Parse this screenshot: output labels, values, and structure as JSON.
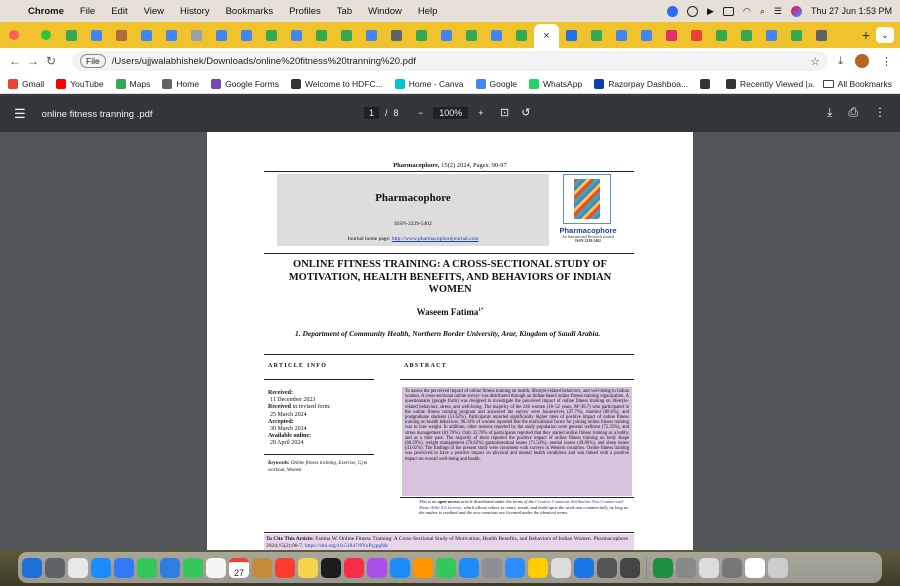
{
  "menubar": {
    "app_name": "Chrome",
    "items": [
      "File",
      "Edit",
      "View",
      "History",
      "Bookmarks",
      "Profiles",
      "Tab",
      "Window",
      "Help"
    ],
    "clock": "Thu 27 Jun  1:53 PM"
  },
  "tabs": {
    "favicon_colors": [
      "#34a853",
      "#4285f4",
      "#b06a3b",
      "#4285f4",
      "#4285f4",
      "#9aa0a6",
      "#4285f4",
      "#4285f4",
      "#34a853",
      "#4285f4",
      "#34a853",
      "#34a853",
      "#4285f4",
      "#5f6368",
      "#34a853",
      "#4285f4",
      "#34a853",
      "#4285f4",
      "#34a853",
      "#1a73e8",
      "#34a853",
      "#4285f4",
      "#4285f4",
      "#e1306c",
      "#ea4335",
      "#34a853",
      "#34a853",
      "#4285f4",
      "#34a853",
      "#5f6368"
    ],
    "active_close": "×",
    "new_tab": "+"
  },
  "toolbar": {
    "file_tag": "File",
    "url": "/Users/ujjwalabhishek/Downloads/online%20fitness%20tranning%20.pdf"
  },
  "bookmarks": {
    "items": [
      {
        "label": "Gmail",
        "color": "#ea4335"
      },
      {
        "label": "YouTube",
        "color": "#ff0000"
      },
      {
        "label": "Maps",
        "color": "#34a853"
      },
      {
        "label": "Home",
        "color": "#5f6368"
      },
      {
        "label": "Google Forms",
        "color": "#7248b9"
      },
      {
        "label": "Welcome to HDFC...",
        "color": "#333"
      },
      {
        "label": "Home - Canva",
        "color": "#00c4cc"
      },
      {
        "label": "Google",
        "color": "#4285f4"
      },
      {
        "label": "WhatsApp",
        "color": "#25d366"
      },
      {
        "label": "Razorpay Dashboa...",
        "color": "#0b3fb3"
      },
      {
        "label": "",
        "color": "#333"
      },
      {
        "label": "Recently Viewed |...",
        "color": "#333"
      }
    ],
    "more": "»",
    "all_bookmarks": "All Bookmarks"
  },
  "pdf": {
    "filename": "online fitness tranning .pdf",
    "page_current": "1",
    "page_sep": "/",
    "page_total": "8",
    "zoom": "100%",
    "zoom_minus": "−",
    "zoom_plus": "+"
  },
  "paper": {
    "journal_line_bold": "Pharmacophore,",
    "journal_line_rest": " 15(2) 2024, Pages: 90-97",
    "box_title": "Pharmacophore",
    "issn": "ISSN-2229-5402",
    "home_prefix": "Journal home page: ",
    "home_link": "http://www.pharmacophorejournal.com",
    "logo_name": "Pharmacophore",
    "logo_sub1": "An International Research Journal",
    "logo_sub2": "ISSN 2229-5402",
    "title": "ONLINE FITNESS TRAINING: A CROSS-SECTIONAL STUDY OF MOTIVATION, HEALTH BENEFITS, AND BEHAVIORS OF INDIAN WOMEN",
    "author": "Waseem Fatima",
    "author_sup": "1*",
    "affiliation": "1.     Department of Community Health, Northern Border University, Arar, Kingdom of Saudi Arabia.",
    "article_info": "ARTICLE INFO",
    "abstract_head": "ABSTRACT",
    "received_label": "Received:",
    "received_date": "11 December 2023",
    "revised_label": "Received",
    "revised_rest": " in revised form:",
    "revised_date": "25 March 2024",
    "accepted_label": "Accepted:",
    "accepted_date": "30 March 2024",
    "available_label": "Available online:",
    "available_date": "28 April 2024",
    "keywords_label": "Keywords:",
    "keywords": " Online fitness training, Exercise, Gym workout, Women",
    "abstract": "To assess the perceived impact of online fitness training on health, lifestyle-related behaviors, and well-being in Indian women. A cross-sectional online survey was distributed through an Indian-based online fitness training organization. A questionnaire (google form) was designed to investigate the perceived impact of online fitness training on lifestyle-related behaviors, stress, and well-being. The majority of the 246 women (18–52 years, M=38.7) who participated in the online fitness training program and answered the survey were housewives (47.7%), married (88.6%), and postgraduate students (51.62%). Participants reported significantly higher rates of positive impact of online fitness training on health behaviors. 96.34% of women reported that the motivational factor for joining online fitness training was to lose weight. In addition, other reasons reported by the study population were general wellness (72.35%), and stress management (81.70%). Only 22.76% of participants reported that they started online fitness training as a hobby and as a time pass. The majority of them reported the positive impact of online fitness training on body shape (68.29%), weight management (76.82%) gastrointestinal issues (71.54%), mental issues (49.86%), and sleep issues (43.02%). The findings of the present study were consistent with surveys in Western countries. Online fitness training was perceived to have a positive impact on physical and mental health conditions and was linked with a positive impact on overall well-being and health.",
    "license_a": "This is an ",
    "license_b": "open-access",
    "license_c": " article distributed under the terms of the ",
    "license_link": "Creative Commons Attribution-Non Commercial-Share Alike 4.0 License",
    "license_d": ", which allows others to remix, tweak, and build upon the work non commercially, as long as the author is credited and the new creations are licensed under the identical terms.",
    "cite_label": "To Cite This Article:",
    "cite_text": " Fatima W. Online Fitness Training: A Cross-Sectional Study of Motivation, Health Benefits, and Behaviors of Indian Women. Pharmacophore. 2024;15(2):90-7. ",
    "cite_link": "https://doi.org/10.51847/8YoPyjpgMc"
  },
  "dock": {
    "icon_colors": [
      "#1e6fd9",
      "#5f6368",
      "#e8e8e8",
      "#1a8cff",
      "#3478f6",
      "#34c759",
      "#2f7de1",
      "#34c759",
      "#f5f5f5",
      "#ffffff",
      "#c38a3a",
      "#ff3b30",
      "#f6d54c",
      "#1c1c1e",
      "#fa2d48",
      "#a950e8",
      "#1d8cf8",
      "#ff9500",
      "#34c759",
      "#1d8cf8",
      "#8e8e93",
      "#2d8cff",
      "#ffcc00",
      "#dddddd",
      "#1a73e8",
      "#555555",
      "#444444",
      "#1e8e3e",
      "#888888",
      "#dddddd",
      "#777777",
      "#ffffff",
      "#cccccc"
    ],
    "calendar_day": "27"
  }
}
